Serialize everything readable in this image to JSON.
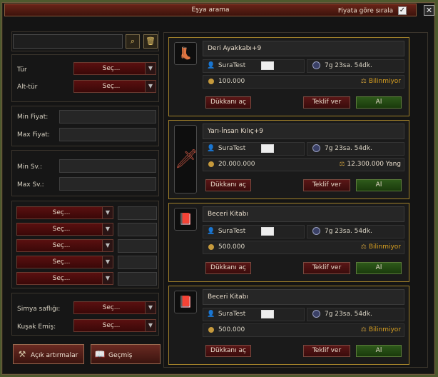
{
  "window": {
    "title": "Eşya arama",
    "sort_label": "Fiyata göre sırala",
    "sort_checked": "✓",
    "close_symbol": "✕"
  },
  "search": {
    "input_value": "",
    "search_icon": "search-icon",
    "trash_icon": "trash-icon"
  },
  "filters": {
    "type_label": "Tür",
    "type_value": "Seç...",
    "subtype_label": "Alt-tür",
    "subtype_value": "Seç...",
    "min_price_label": "Min Fiyat:",
    "max_price_label": "Max Fiyat:",
    "min_level_label": "Min Sv.:",
    "max_level_label": "Max Sv.:",
    "bonus_selects": [
      "Seç...",
      "Seç...",
      "Seç...",
      "Seç...",
      "Seç..."
    ],
    "alchemy_label": "Simya saflığı:",
    "alchemy_value": "Seç...",
    "belt_label": "Kuşak Emiş:",
    "belt_value": "Seç..."
  },
  "bottom_buttons": {
    "open_auctions": "Açık artırmalar",
    "history": "Geçmiş"
  },
  "listings": [
    {
      "name": "Deri Ayakkabı+9",
      "seller": "SuraTest",
      "time": "7g 23sa. 54dk.",
      "price": "100.000",
      "estimate": "Bilinmiyor",
      "icon": "boots-icon"
    },
    {
      "name": "Yarı-İnsan Kılıç+9",
      "seller": "SuraTest",
      "time": "7g 23sa. 54dk.",
      "price": "20.000.000",
      "estimate": "12.300.000 Yang",
      "icon": "sword-icon"
    },
    {
      "name": "Beceri Kitabı",
      "seller": "SuraTest",
      "time": "7g 23sa. 54dk.",
      "price": "500.000",
      "estimate": "Bilinmiyor",
      "icon": "book-icon"
    },
    {
      "name": "Beceri Kitabı",
      "seller": "SuraTest",
      "time": "7g 23sa. 54dk.",
      "price": "500.000",
      "estimate": "Bilinmiyor",
      "icon": "book-icon"
    }
  ],
  "listing_actions": {
    "open_shop": "Dükkanı aç",
    "make_offer": "Teklif ver",
    "buy": "Al"
  }
}
